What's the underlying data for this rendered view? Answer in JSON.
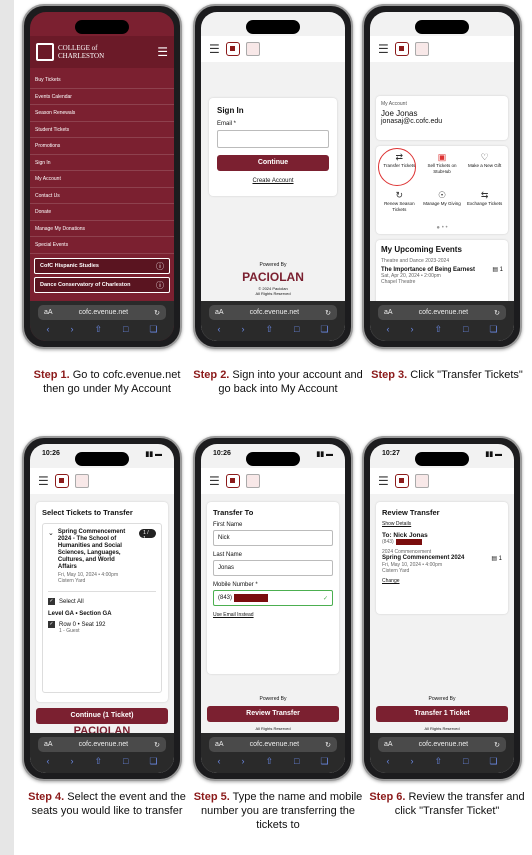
{
  "steps": [
    {
      "caption_bold": "Step 1.",
      "caption_text": " Go to cofc.evenue.net then go under My Account",
      "college_title": "COLLEGE of CHARLESTON",
      "menu_items": [
        "Buy Tickets",
        "Events Calendar",
        "Season Renewals",
        "Student Tickets",
        "Promotions",
        "Sign In",
        "My Account",
        "Contact Us",
        "Donate",
        "Manage My Donations",
        "Special Events"
      ],
      "sub_items": [
        "CofC Hispanic Studies",
        "Dance Conservatory of Charleston"
      ],
      "url": "cofc.evenue.net"
    },
    {
      "caption_bold": "Step 2.",
      "caption_text": " Sign into your account and go back into My Account",
      "heading": "Sign In",
      "email_label": "Email *",
      "continue_label": "Continue",
      "create_label": "Create Account",
      "powered": "Powered By",
      "brand": "PACIOLAN",
      "copy1": "© 2024 Paciolan",
      "copy2": "All Rights Reserved",
      "url": "cofc.evenue.net"
    },
    {
      "caption_bold": "Step 3.",
      "caption_text": " Click \"Transfer Tickets\"",
      "account_label": "My Account",
      "name": "Joe Jonas",
      "email": "jonasaj@c.cofc.edu",
      "actions": [
        "Transfer Tickets",
        "Sell Tickets on StubHub",
        "Make a New Gift",
        "Renew Season Tickets",
        "Manage My Giving",
        "Exchange Tickets"
      ],
      "upcoming": "My Upcoming Events",
      "season": "Theatre and Dance 2023-2024",
      "event": "The Importance of Being Earnest",
      "count": "1",
      "date": "Sat, Apr 20, 2024 • 2:00pm",
      "venue": "Chapel Theatre",
      "url": "cofc.evenue.net"
    },
    {
      "caption_bold": "Step 4.",
      "caption_text": " Select the event and the seats you would like to transfer",
      "time": "10:26",
      "heading": "Select Tickets to Transfer",
      "event": "Spring Commencement 2024 - The School of Humanities and Social Sciences, Languages, Cultures, and World Affairs",
      "badge": "1 / 1",
      "date": "Fri, May 10, 2024 • 4:00pm",
      "venue": "Cistern Yard",
      "select_all": "Select All",
      "level": "Level GA • Section GA",
      "seat": "Row 0 • Seat 192",
      "guest": "1 - Guest",
      "button": "Continue (1 Ticket)",
      "brand": "PACIOLAN",
      "url": "cofc.evenue.net"
    },
    {
      "caption_bold": "Step 5.",
      "caption_text": " Type the name and mobile number you are transferring the tickets to",
      "time": "10:26",
      "heading": "Transfer To",
      "first_label": "First Name",
      "first_value": "Nick",
      "last_label": "Last Name",
      "last_value": "Jonas",
      "mobile_label": "Mobile Number *",
      "mobile_value": "(843)",
      "email_link": "Use Email Instead",
      "powered": "Powered By",
      "button": "Review Transfer",
      "rights": "All Rights Reserved",
      "url": "cofc.evenue.net"
    },
    {
      "caption_bold": "Step 6.",
      "caption_text": " Review the transfer and click \"Transfer Ticket\"",
      "time": "10:27",
      "heading": "Review Transfer",
      "details": "Show Details",
      "to": "To: Nick Jonas",
      "phone": "(843)",
      "season": "2024 Commencement",
      "event": "Spring Commencement 2024",
      "count": "1",
      "date": "Fri, May 10, 2024 • 4:00pm",
      "venue": "Cistern Yard",
      "change": "Change",
      "powered": "Powered By",
      "button": "Transfer 1 Ticket",
      "rights": "All Rights Reserved",
      "url": "cofc.evenue.net"
    }
  ],
  "colors": {
    "maroon": "#7b2030",
    "caption_red": "#8b1a1a",
    "redact": "#7a0d0d"
  }
}
